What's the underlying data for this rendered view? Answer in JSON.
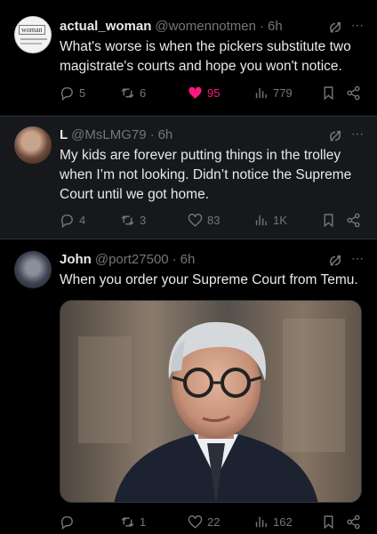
{
  "tweets": [
    {
      "avatar_text": "woman",
      "name": "actual_woman",
      "handle": "@womennotmen",
      "dot": "·",
      "time": "6h",
      "text": "What's worse is when the pickers substitute two magistrate's courts and hope you won't notice.",
      "replies": "5",
      "reposts": "6",
      "likes": "95",
      "views": "779",
      "liked": true
    },
    {
      "name": "L",
      "handle": "@MsLMG79",
      "dot": "·",
      "time": "6h",
      "text": "My kids are forever putting things in the trolley when I’m not looking. Didn’t notice the Supreme Court until we got home.",
      "replies": "4",
      "reposts": "3",
      "likes": "83",
      "views": "1K"
    },
    {
      "name": "John",
      "handle": "@port27500",
      "dot": "·",
      "time": "6h",
      "text": "When you order your Supreme Court from Temu.",
      "replies": "",
      "reposts": "1",
      "likes": "22",
      "views": "162"
    }
  ],
  "colors": {
    "background": "#000000",
    "highlight_background": "#16181c",
    "text": "#e7e9ea",
    "muted": "#71767b",
    "like": "#f91880"
  },
  "icons": {
    "more": "⋯",
    "grok": "grok-icon",
    "reply": "reply-icon",
    "repost": "repost-icon",
    "like": "heart-icon",
    "views": "views-icon",
    "bookmark": "bookmark-icon",
    "share": "share-icon"
  }
}
